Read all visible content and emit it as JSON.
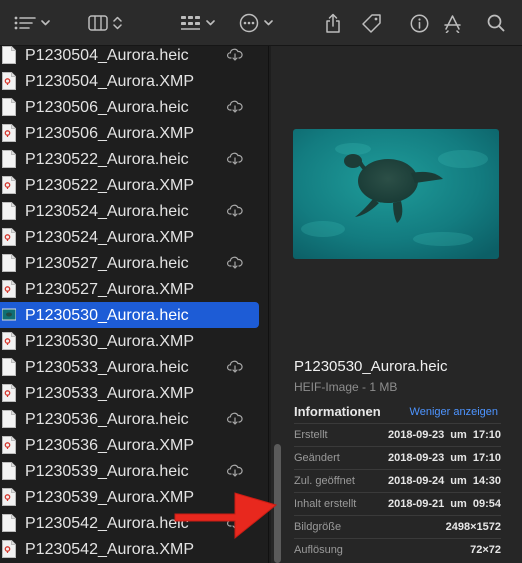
{
  "toolbar": {
    "icons": [
      "list-view-icon",
      "chevron-down-icon",
      "columns-view-icon",
      "sort-updown-icon",
      "grid-group-icon",
      "chevron-down-icon",
      "more-ellipsis-icon",
      "chevron-down-icon",
      "share-icon",
      "tag-icon",
      "info-icon",
      "edit-markup-icon",
      "search-icon"
    ]
  },
  "files": [
    {
      "name": "P1230504_Aurora.heic",
      "kind": "heic",
      "cloud": true
    },
    {
      "name": "P1230504_Aurora.XMP",
      "kind": "xmp",
      "cloud": false
    },
    {
      "name": "P1230506_Aurora.heic",
      "kind": "heic",
      "cloud": true
    },
    {
      "name": "P1230506_Aurora.XMP",
      "kind": "xmp",
      "cloud": false
    },
    {
      "name": "P1230522_Aurora.heic",
      "kind": "heic",
      "cloud": true
    },
    {
      "name": "P1230522_Aurora.XMP",
      "kind": "xmp",
      "cloud": false
    },
    {
      "name": "P1230524_Aurora.heic",
      "kind": "heic",
      "cloud": true
    },
    {
      "name": "P1230524_Aurora.XMP",
      "kind": "xmp",
      "cloud": false
    },
    {
      "name": "P1230527_Aurora.heic",
      "kind": "heic",
      "cloud": true
    },
    {
      "name": "P1230527_Aurora.XMP",
      "kind": "xmp",
      "cloud": false
    },
    {
      "name": "P1230530_Aurora.heic",
      "kind": "image",
      "cloud": false,
      "selected": true
    },
    {
      "name": "P1230530_Aurora.XMP",
      "kind": "xmp",
      "cloud": false
    },
    {
      "name": "P1230533_Aurora.heic",
      "kind": "heic",
      "cloud": true
    },
    {
      "name": "P1230533_Aurora.XMP",
      "kind": "xmp",
      "cloud": false
    },
    {
      "name": "P1230536_Aurora.heic",
      "kind": "heic",
      "cloud": true
    },
    {
      "name": "P1230536_Aurora.XMP",
      "kind": "xmp",
      "cloud": false
    },
    {
      "name": "P1230539_Aurora.heic",
      "kind": "heic",
      "cloud": true
    },
    {
      "name": "P1230539_Aurora.XMP",
      "kind": "xmp",
      "cloud": false
    },
    {
      "name": "P1230542_Aurora.heic",
      "kind": "heic",
      "cloud": true
    },
    {
      "name": "P1230542_Aurora.XMP",
      "kind": "xmp",
      "cloud": false
    }
  ],
  "preview": {
    "title": "P1230530_Aurora.heic",
    "subtitle": "HEIF-Image - 1 MB",
    "info_heading": "Informationen",
    "info_toggle": "Weniger anzeigen",
    "rows": [
      {
        "label": "Erstellt",
        "value": "2018-09-23  um 17:10"
      },
      {
        "label": "Geändert",
        "value": "2018-09-23  um 17:10"
      },
      {
        "label": "Zul. geöffnet",
        "value": "2018-09-24  um 14:30"
      },
      {
        "label": "Inhalt erstellt",
        "value": "2018-09-21  um 09:54"
      },
      {
        "label": "Bildgröße",
        "value": "2498×1572"
      },
      {
        "label": "Auflösung",
        "value": "72×72"
      }
    ]
  },
  "colors": {
    "selection": "#1d5cd6",
    "annotation_arrow": "#e8281e",
    "link": "#4d94ff"
  }
}
